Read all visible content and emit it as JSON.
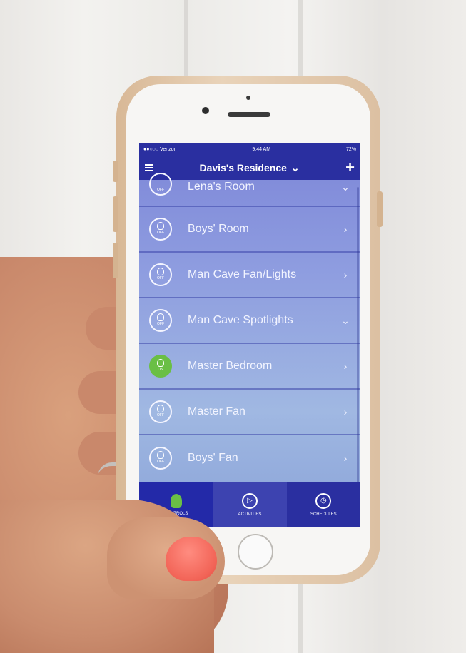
{
  "status_bar": {
    "carrier": "●●○○○ Verizon",
    "time": "9:44 AM",
    "battery": "72%"
  },
  "nav": {
    "title": "Davis's Residence",
    "add_label": "+"
  },
  "rooms": [
    {
      "label": "Lena's Room",
      "state": "OFF",
      "chevron": "⌄"
    },
    {
      "label": "Boys' Room",
      "state": "OFF",
      "chevron": "›"
    },
    {
      "label": "Man Cave Fan/Lights",
      "state": "OFF",
      "chevron": "›"
    },
    {
      "label": "Man Cave Spotlights",
      "state": "OFF",
      "chevron": "⌄"
    },
    {
      "label": "Master Bedroom",
      "state": "ON",
      "chevron": "›"
    },
    {
      "label": "Master Fan",
      "state": "OFF",
      "chevron": "›"
    },
    {
      "label": "Boys' Fan",
      "state": "OFF",
      "chevron": "›"
    }
  ],
  "tabs": [
    {
      "label": "CONTROLS",
      "icon": "bulb-icon",
      "glyph": ""
    },
    {
      "label": "ACTIVITIES",
      "icon": "play-icon",
      "glyph": "▷"
    },
    {
      "label": "SCHEDULES",
      "icon": "clock-icon",
      "glyph": "◷"
    }
  ],
  "colors": {
    "accent": "#2a2fa0",
    "on": "#6abf45"
  }
}
